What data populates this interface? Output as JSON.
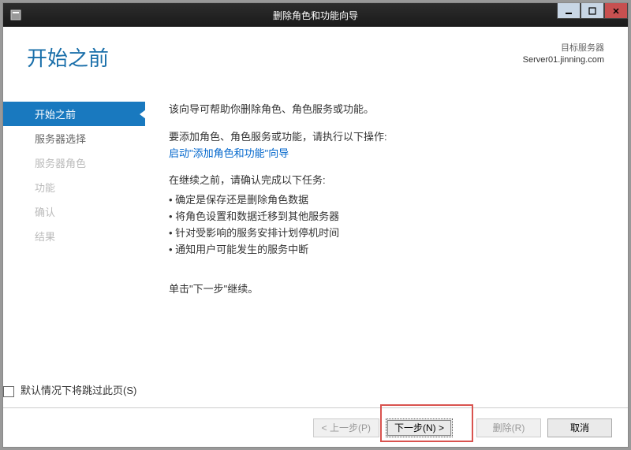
{
  "titlebar": {
    "title": "删除角色和功能向导"
  },
  "header": {
    "page_title": "开始之前",
    "dest_label": "目标服务器",
    "dest_server": "Server01.jinning.com"
  },
  "sidebar": {
    "items": [
      {
        "label": "开始之前",
        "state": "active"
      },
      {
        "label": "服务器选择",
        "state": "enabled"
      },
      {
        "label": "服务器角色",
        "state": "disabled"
      },
      {
        "label": "功能",
        "state": "disabled"
      },
      {
        "label": "确认",
        "state": "disabled"
      },
      {
        "label": "结果",
        "state": "disabled"
      }
    ]
  },
  "content": {
    "intro": "该向导可帮助你删除角色、角色服务或功能。",
    "add_hint": "要添加角色、角色服务或功能，请执行以下操作:",
    "add_link": "启动\"添加角色和功能\"向导",
    "pre_tasks": "在继续之前，请确认完成以下任务:",
    "bullets": [
      "确定是保存还是删除角色数据",
      "将角色设置和数据迁移到其他服务器",
      "针对受影响的服务安排计划停机时间",
      "通知用户可能发生的服务中断"
    ],
    "continue_hint": "单击\"下一步\"继续。",
    "skip_label": "默认情况下将跳过此页(S)"
  },
  "footer": {
    "prev": "< 上一步(P)",
    "next": "下一步(N) >",
    "remove": "删除(R)",
    "cancel": "取消"
  }
}
